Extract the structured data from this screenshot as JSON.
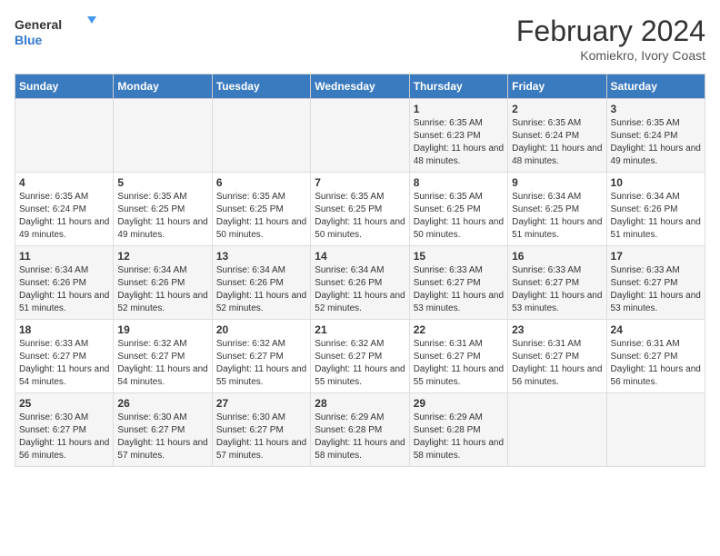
{
  "logo": {
    "general": "General",
    "blue": "Blue"
  },
  "title": "February 2024",
  "subtitle": "Komiekro, Ivory Coast",
  "days_of_week": [
    "Sunday",
    "Monday",
    "Tuesday",
    "Wednesday",
    "Thursday",
    "Friday",
    "Saturday"
  ],
  "weeks": [
    [
      {
        "day": "",
        "info": ""
      },
      {
        "day": "",
        "info": ""
      },
      {
        "day": "",
        "info": ""
      },
      {
        "day": "",
        "info": ""
      },
      {
        "day": "1",
        "info": "Sunrise: 6:35 AM\nSunset: 6:23 PM\nDaylight: 11 hours and 48 minutes."
      },
      {
        "day": "2",
        "info": "Sunrise: 6:35 AM\nSunset: 6:24 PM\nDaylight: 11 hours and 48 minutes."
      },
      {
        "day": "3",
        "info": "Sunrise: 6:35 AM\nSunset: 6:24 PM\nDaylight: 11 hours and 49 minutes."
      }
    ],
    [
      {
        "day": "4",
        "info": "Sunrise: 6:35 AM\nSunset: 6:24 PM\nDaylight: 11 hours and 49 minutes."
      },
      {
        "day": "5",
        "info": "Sunrise: 6:35 AM\nSunset: 6:25 PM\nDaylight: 11 hours and 49 minutes."
      },
      {
        "day": "6",
        "info": "Sunrise: 6:35 AM\nSunset: 6:25 PM\nDaylight: 11 hours and 50 minutes."
      },
      {
        "day": "7",
        "info": "Sunrise: 6:35 AM\nSunset: 6:25 PM\nDaylight: 11 hours and 50 minutes."
      },
      {
        "day": "8",
        "info": "Sunrise: 6:35 AM\nSunset: 6:25 PM\nDaylight: 11 hours and 50 minutes."
      },
      {
        "day": "9",
        "info": "Sunrise: 6:34 AM\nSunset: 6:25 PM\nDaylight: 11 hours and 51 minutes."
      },
      {
        "day": "10",
        "info": "Sunrise: 6:34 AM\nSunset: 6:26 PM\nDaylight: 11 hours and 51 minutes."
      }
    ],
    [
      {
        "day": "11",
        "info": "Sunrise: 6:34 AM\nSunset: 6:26 PM\nDaylight: 11 hours and 51 minutes."
      },
      {
        "day": "12",
        "info": "Sunrise: 6:34 AM\nSunset: 6:26 PM\nDaylight: 11 hours and 52 minutes."
      },
      {
        "day": "13",
        "info": "Sunrise: 6:34 AM\nSunset: 6:26 PM\nDaylight: 11 hours and 52 minutes."
      },
      {
        "day": "14",
        "info": "Sunrise: 6:34 AM\nSunset: 6:26 PM\nDaylight: 11 hours and 52 minutes."
      },
      {
        "day": "15",
        "info": "Sunrise: 6:33 AM\nSunset: 6:27 PM\nDaylight: 11 hours and 53 minutes."
      },
      {
        "day": "16",
        "info": "Sunrise: 6:33 AM\nSunset: 6:27 PM\nDaylight: 11 hours and 53 minutes."
      },
      {
        "day": "17",
        "info": "Sunrise: 6:33 AM\nSunset: 6:27 PM\nDaylight: 11 hours and 53 minutes."
      }
    ],
    [
      {
        "day": "18",
        "info": "Sunrise: 6:33 AM\nSunset: 6:27 PM\nDaylight: 11 hours and 54 minutes."
      },
      {
        "day": "19",
        "info": "Sunrise: 6:32 AM\nSunset: 6:27 PM\nDaylight: 11 hours and 54 minutes."
      },
      {
        "day": "20",
        "info": "Sunrise: 6:32 AM\nSunset: 6:27 PM\nDaylight: 11 hours and 55 minutes."
      },
      {
        "day": "21",
        "info": "Sunrise: 6:32 AM\nSunset: 6:27 PM\nDaylight: 11 hours and 55 minutes."
      },
      {
        "day": "22",
        "info": "Sunrise: 6:31 AM\nSunset: 6:27 PM\nDaylight: 11 hours and 55 minutes."
      },
      {
        "day": "23",
        "info": "Sunrise: 6:31 AM\nSunset: 6:27 PM\nDaylight: 11 hours and 56 minutes."
      },
      {
        "day": "24",
        "info": "Sunrise: 6:31 AM\nSunset: 6:27 PM\nDaylight: 11 hours and 56 minutes."
      }
    ],
    [
      {
        "day": "25",
        "info": "Sunrise: 6:30 AM\nSunset: 6:27 PM\nDaylight: 11 hours and 56 minutes."
      },
      {
        "day": "26",
        "info": "Sunrise: 6:30 AM\nSunset: 6:27 PM\nDaylight: 11 hours and 57 minutes."
      },
      {
        "day": "27",
        "info": "Sunrise: 6:30 AM\nSunset: 6:27 PM\nDaylight: 11 hours and 57 minutes."
      },
      {
        "day": "28",
        "info": "Sunrise: 6:29 AM\nSunset: 6:28 PM\nDaylight: 11 hours and 58 minutes."
      },
      {
        "day": "29",
        "info": "Sunrise: 6:29 AM\nSunset: 6:28 PM\nDaylight: 11 hours and 58 minutes."
      },
      {
        "day": "",
        "info": ""
      },
      {
        "day": "",
        "info": ""
      }
    ]
  ]
}
